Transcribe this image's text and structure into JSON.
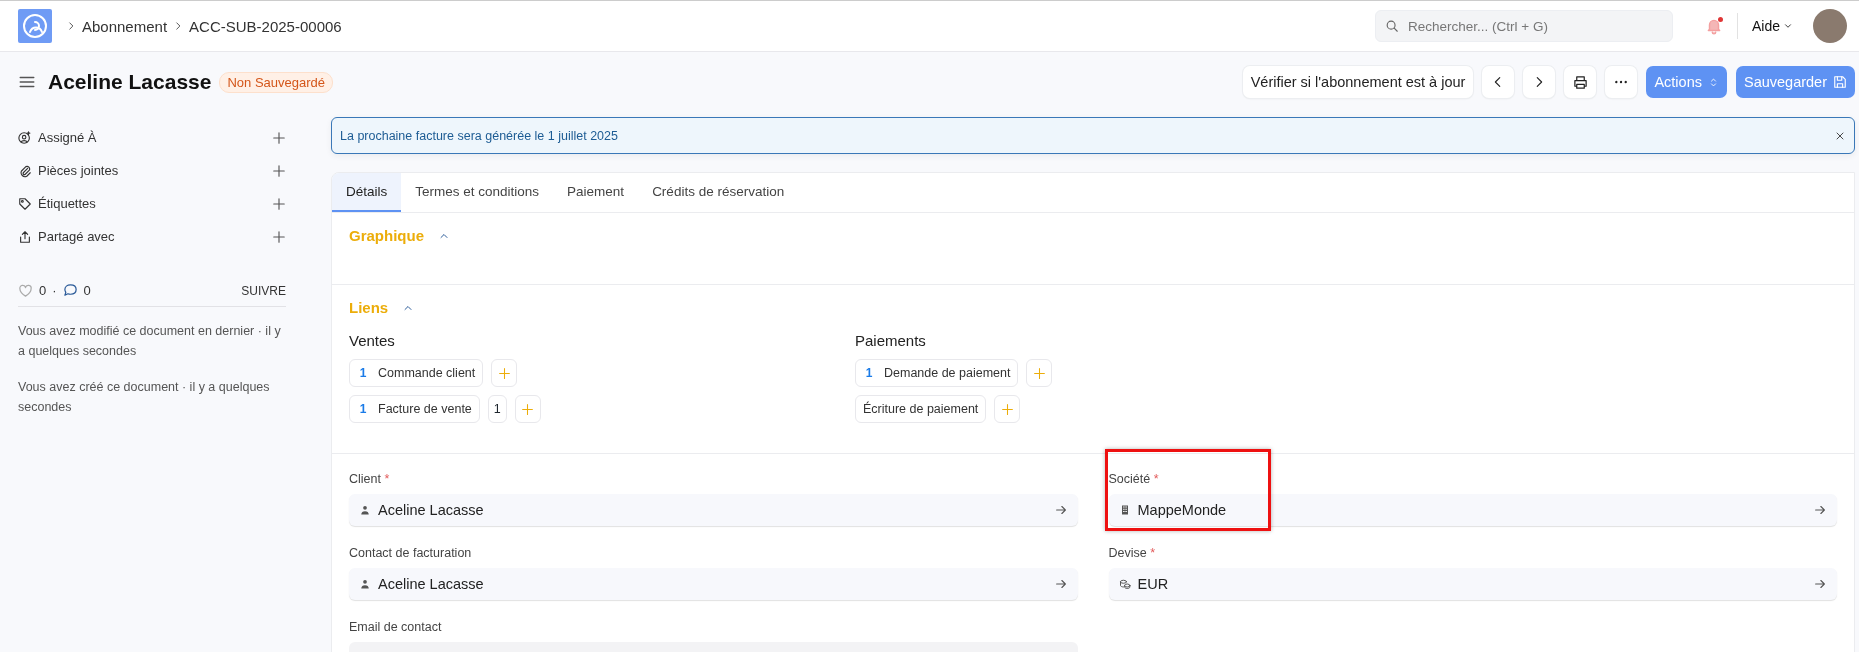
{
  "topbar": {
    "breadcrumbs": [
      "Abonnement",
      "ACC-SUB-2025-00006"
    ],
    "search": {
      "placeholder": "Rechercher... (Ctrl + G)"
    },
    "notifications_unread": true,
    "help": "Aide"
  },
  "header": {
    "title": "Aceline Lacasse",
    "status": "Non Sauvegardé",
    "buttons": [
      {
        "kind": "text",
        "label": "Vérifier si l'abonnement est à jour"
      },
      {
        "kind": "prev"
      },
      {
        "kind": "next"
      },
      {
        "kind": "print"
      },
      {
        "kind": "more"
      },
      {
        "kind": "dropdown",
        "label": "Actions"
      },
      {
        "kind": "save",
        "label": "Sauvegarder"
      }
    ]
  },
  "sidebar": {
    "items": [
      {
        "kind": "assign",
        "label": "Assigné À"
      },
      {
        "kind": "attach",
        "label": "Pièces jointes"
      },
      {
        "kind": "tag",
        "label": "Étiquettes"
      },
      {
        "kind": "share",
        "label": "Partagé avec"
      }
    ],
    "likes": "0",
    "separator": "·",
    "comments": "0",
    "follow": "SUIVRE",
    "activity": [
      "Vous avez modifié ce document en dernier · il y a quelques secondes",
      "Vous avez créé ce document · il y a quelques secondes"
    ]
  },
  "alert": {
    "text": "La prochaine facture sera générée le 1 juillet 2025"
  },
  "tabs": [
    {
      "label": "Détails",
      "selected": true
    },
    {
      "label": "Termes et conditions",
      "selected": false
    },
    {
      "label": "Paiement",
      "selected": false
    },
    {
      "label": "Crédits de réservation",
      "selected": false
    }
  ],
  "sections": [
    {
      "title": "Graphique",
      "expanded": true
    },
    {
      "title": "Liens",
      "expanded": true,
      "groups": [
        {
          "title": "Ventes",
          "links": [
            {
              "count": "1",
              "label": "Commande client"
            },
            {
              "count": "1",
              "label": "Facture de vente",
              "extra": "1"
            }
          ]
        },
        {
          "title": "Paiements",
          "links": [
            {
              "count": "1",
              "label": "Demande de paiement"
            },
            {
              "label": "Écriture de paiement"
            }
          ]
        }
      ]
    }
  ],
  "form": {
    "left": [
      {
        "kind": "person",
        "label": "Client",
        "required_mark": "*",
        "value": "Aceline Lacasse",
        "highlighted": false
      },
      {
        "kind": "person",
        "label": "Contact de facturation",
        "value": "Aceline Lacasse",
        "highlighted": false
      },
      {
        "kind": "text",
        "label": "Email de contact",
        "highlighted": false
      }
    ],
    "right": [
      {
        "kind": "company",
        "label": "Société",
        "required_mark": "*",
        "value": "MappeMonde",
        "highlighted": true
      },
      {
        "kind": "currency",
        "label": "Devise",
        "required_mark": "*",
        "value": "EUR",
        "highlighted": false
      }
    ]
  }
}
